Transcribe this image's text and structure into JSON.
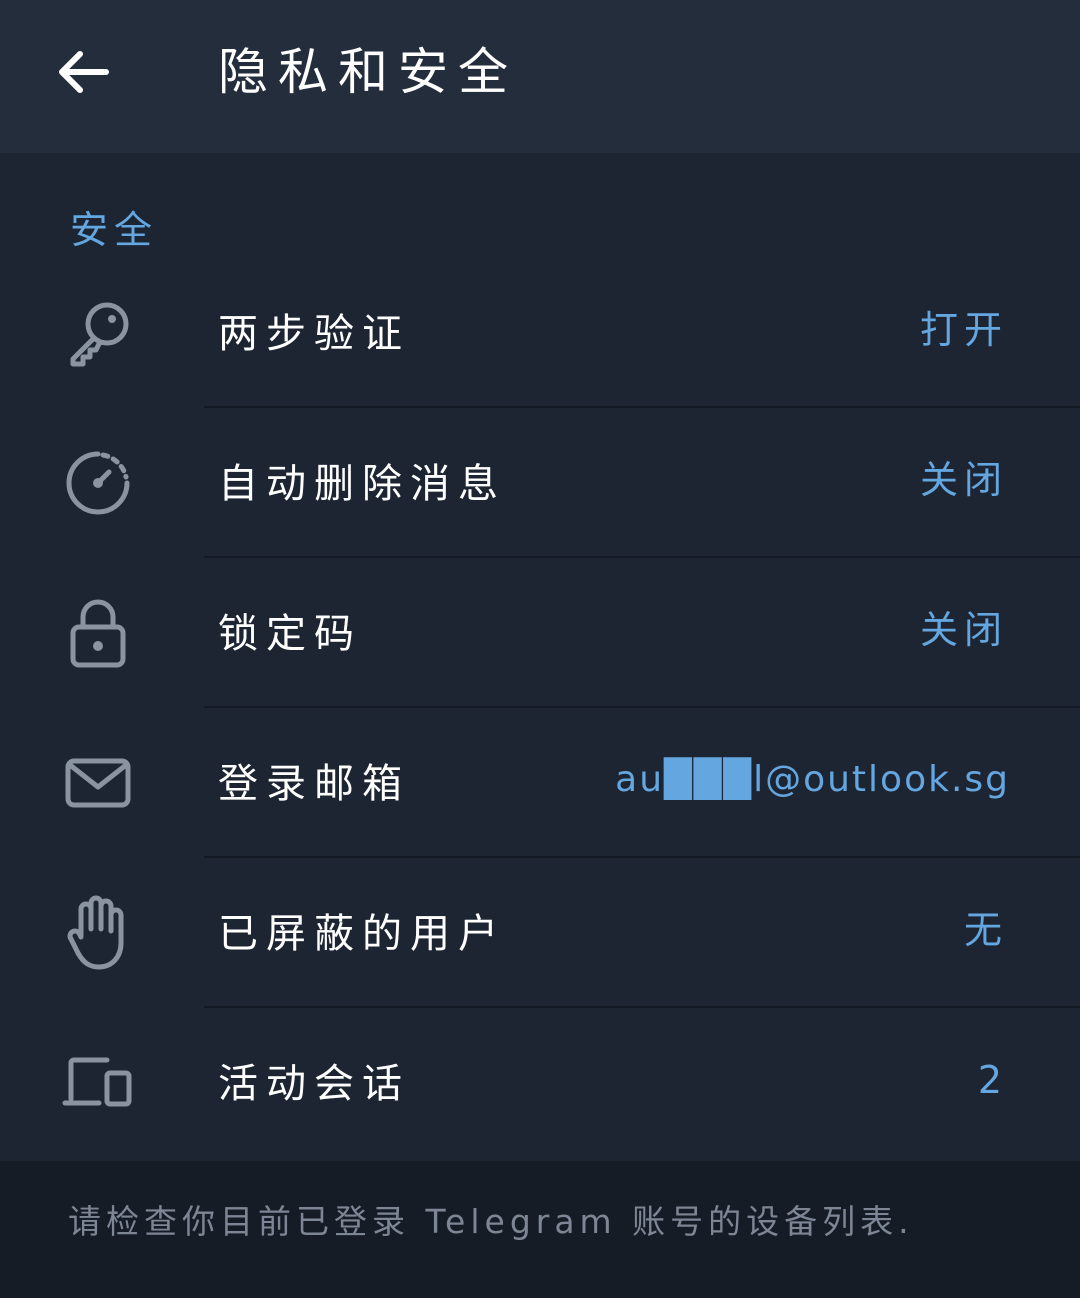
{
  "header": {
    "title": "隐私和安全",
    "back_icon": "arrow-left-icon"
  },
  "section": {
    "title": "安全",
    "items": [
      {
        "icon": "key-icon",
        "label": "两步验证",
        "value": "打开"
      },
      {
        "icon": "timer-icon",
        "label": "自动删除消息",
        "value": "关闭"
      },
      {
        "icon": "lock-icon",
        "label": "锁定码",
        "value": "关闭"
      },
      {
        "icon": "mail-icon",
        "label": "登录邮箱",
        "value": "au███l@outlook.sg"
      },
      {
        "icon": "hand-icon",
        "label": "已屏蔽的用户",
        "value": "无"
      },
      {
        "icon": "devices-icon",
        "label": "活动会话",
        "value": "2"
      }
    ]
  },
  "footer": {
    "text": "请检查你目前已登录 Telegram 账号的设备列表."
  },
  "colors": {
    "background": "#1d2533",
    "appbar": "#242d3c",
    "accent": "#64a6e0",
    "footer_bg": "#161c26",
    "icon": "#8a93a0"
  }
}
